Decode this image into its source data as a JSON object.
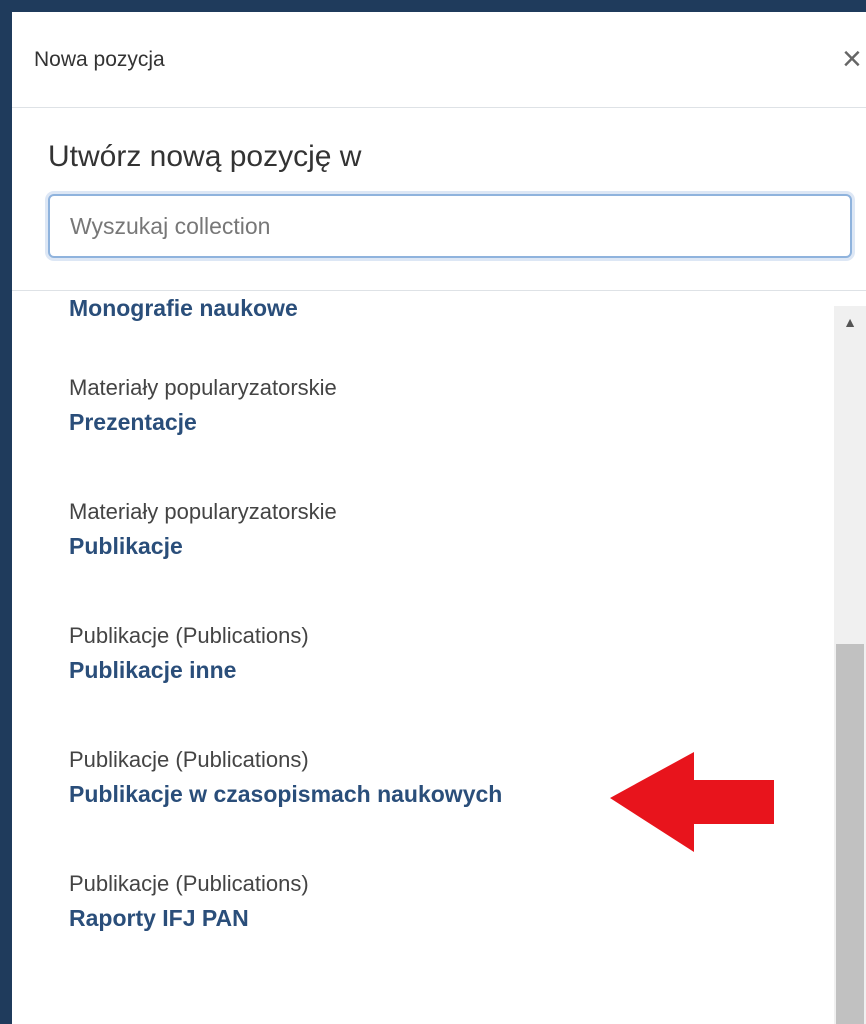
{
  "modal": {
    "title": "Nowa pozycja",
    "close_symbol": "×"
  },
  "subtitle": "Utwórz nową pozycję w",
  "search": {
    "placeholder": "Wyszukaj collection",
    "value": ""
  },
  "items": [
    {
      "parent": "",
      "name": "Monografie naukowe"
    },
    {
      "parent": "Materiały popularyzatorskie",
      "name": "Prezentacje"
    },
    {
      "parent": "Materiały popularyzatorskie",
      "name": "Publikacje"
    },
    {
      "parent": "Publikacje (Publications)",
      "name": "Publikacje inne"
    },
    {
      "parent": "Publikacje (Publications)",
      "name": "Publikacje w czasopismach naukowych"
    },
    {
      "parent": "Publikacje (Publications)",
      "name": "Raporty IFJ PAN"
    }
  ],
  "scrollbar": {
    "up_symbol": "▲"
  },
  "annotation": {
    "arrow_color": "#e8141c",
    "points_to_item": 4
  },
  "colors": {
    "backdrop": "#1f3b5c",
    "link": "#2a4e7a",
    "focus_border": "#8fb3dd"
  }
}
